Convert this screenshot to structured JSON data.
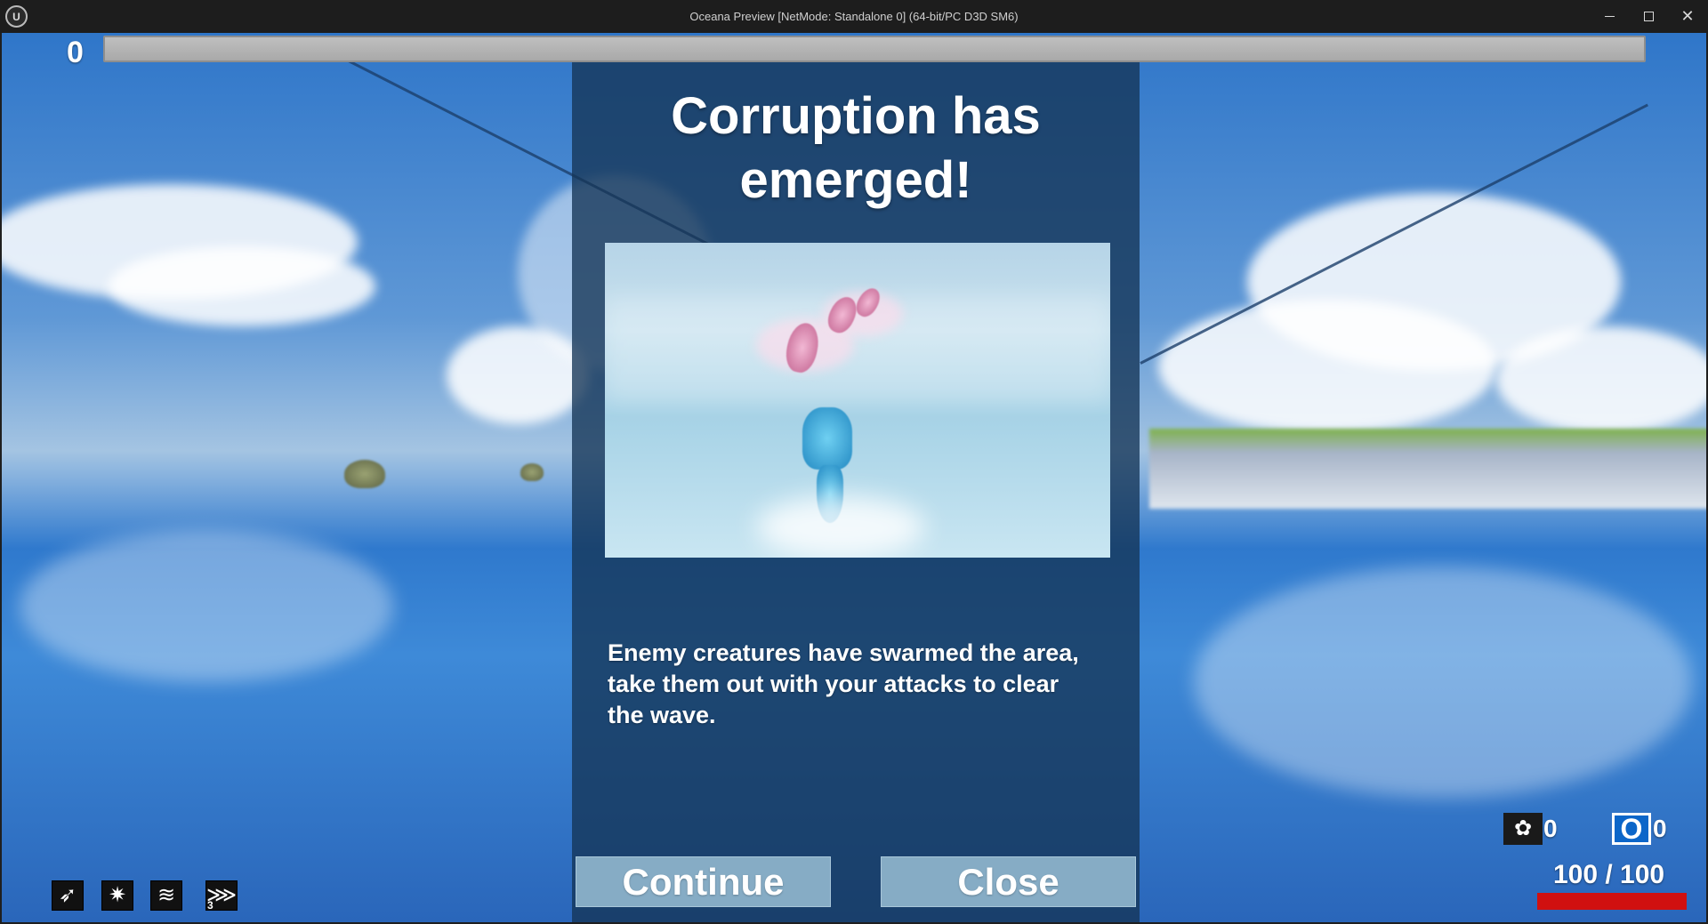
{
  "window": {
    "title": "Oceana Preview [NetMode: Standalone 0]  (64-bit/PC D3D SM6)",
    "logo_glyph": "U",
    "minimize_icon": "minimize-icon",
    "maximize_icon": "maximize-icon",
    "close_glyph": "✕"
  },
  "hud": {
    "score": "0",
    "wave_progress_fraction": 0,
    "abilities": [
      {
        "icon": "dash-icon",
        "glyph": "➶"
      },
      {
        "icon": "swirl-icon",
        "glyph": "✷"
      },
      {
        "icon": "wave-lines-icon",
        "glyph": "≋"
      },
      {
        "icon": "claw-slash-icon",
        "glyph": "⋙",
        "count": "3"
      }
    ],
    "shell_icon_glyph": "✿",
    "shell_count": "0",
    "gem_icon_glyph": "O",
    "gem_count": "0",
    "health_text": "100 / 100",
    "health_fraction": 1.0
  },
  "modal": {
    "title": "Corruption has\nemerged!",
    "body": "Enemy creatures have swarmed the area,\ntake them out with your attacks to clear\n the wave.",
    "continue_label": "Continue",
    "close_label": "Close"
  },
  "colors": {
    "health": "#d01010",
    "panel": "#143456",
    "button": "#8fb5cd"
  }
}
